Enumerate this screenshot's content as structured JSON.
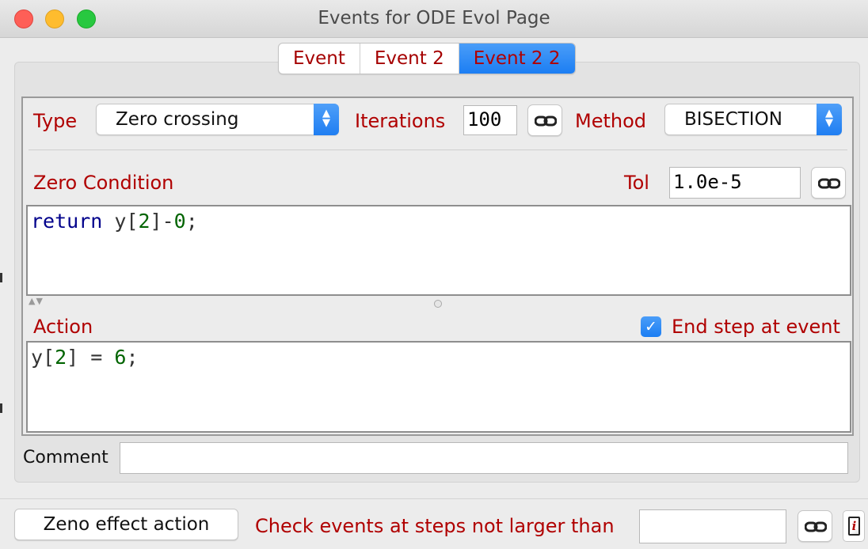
{
  "window": {
    "title": "Events for ODE Evol Page"
  },
  "tabs": [
    {
      "label": "Event",
      "active": false
    },
    {
      "label": "Event 2",
      "active": false
    },
    {
      "label": "Event 2 2",
      "active": true
    }
  ],
  "event": {
    "type_label": "Type",
    "type_value": "Zero crossing",
    "iterations_label": "Iterations",
    "iterations_value": "100",
    "method_label": "Method",
    "method_value": "BISECTION",
    "zero_condition_label": "Zero Condition",
    "tol_label": "Tol",
    "tol_value": "1.0e-5",
    "zero_condition_code": {
      "kw": "return",
      "rest": " y[",
      "n1": "2",
      "mid": "]-",
      "n2": "0",
      "end": ";"
    },
    "action_label": "Action",
    "end_step_label": "End step at event",
    "end_step_checked": true,
    "action_code": {
      "pre": "y[",
      "n1": "2",
      "mid": "] = ",
      "n2": "6",
      "end": ";"
    },
    "comment_label": "Comment",
    "comment_value": ""
  },
  "footer": {
    "zeno_button": "Zeno effect action",
    "check_label": "Check events at steps not larger than",
    "check_value": ""
  },
  "colors": {
    "label_red": "#b00000",
    "accent_blue": "#1c7ef3",
    "keyword": "#00008b",
    "number": "#006400"
  },
  "icons": [
    "close-light",
    "minimize-light",
    "maximize-light",
    "link-icon",
    "chevron-updown-icon",
    "checkmark-icon",
    "info-icon"
  ]
}
